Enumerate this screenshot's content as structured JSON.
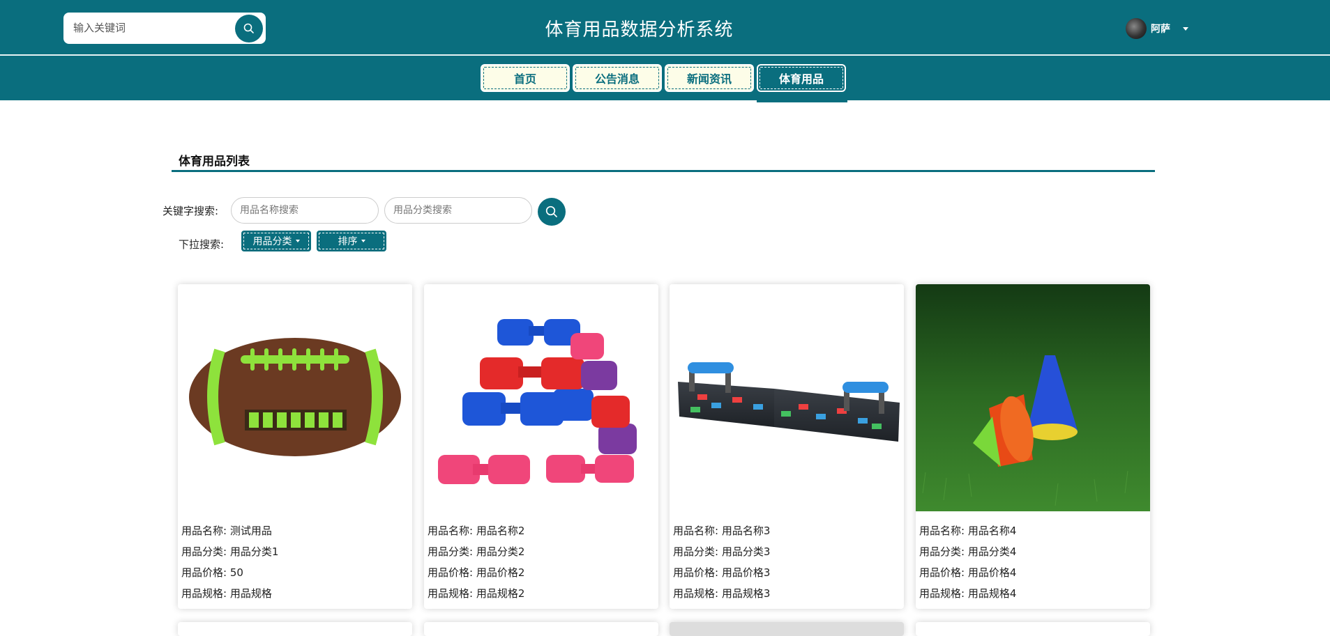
{
  "header": {
    "search_placeholder": "输入关键词",
    "site_title": "体育用品数据分析系统",
    "user_name": "阿萨"
  },
  "nav": {
    "items": [
      {
        "label": "首页"
      },
      {
        "label": "公告消息"
      },
      {
        "label": "新闻资讯"
      },
      {
        "label": "体育用品"
      }
    ],
    "active_index": 3
  },
  "section": {
    "title": "体育用品列表",
    "keyword_label": "关键字搜索:",
    "name_placeholder": "用品名称搜索",
    "category_placeholder": "用品分类搜索",
    "dropdown_label": "下拉搜索:",
    "category_dropdown": "用品分类",
    "sort_dropdown": "排序"
  },
  "products": [
    {
      "image": "football",
      "name": "用品名称: 测试用品",
      "category": "用品分类: 用品分类1",
      "price": "用品价格: 50",
      "spec": "用品规格: 用品规格"
    },
    {
      "image": "dumbbells",
      "name": "用品名称: 用品名称2",
      "category": "用品分类: 用品分类2",
      "price": "用品价格: 用品价格2",
      "spec": "用品规格: 用品规格2"
    },
    {
      "image": "pushup-board",
      "name": "用品名称: 用品名称3",
      "category": "用品分类: 用品分类3",
      "price": "用品价格: 用品价格3",
      "spec": "用品规格: 用品规格3"
    },
    {
      "image": "training-cones",
      "name": "用品名称: 用品名称4",
      "category": "用品分类: 用品分类4",
      "price": "用品价格: 用品价格4",
      "spec": "用品规格: 用品规格4"
    }
  ],
  "colors": {
    "primary": "#0a6e7e",
    "nav_bg": "#fdfde8"
  }
}
